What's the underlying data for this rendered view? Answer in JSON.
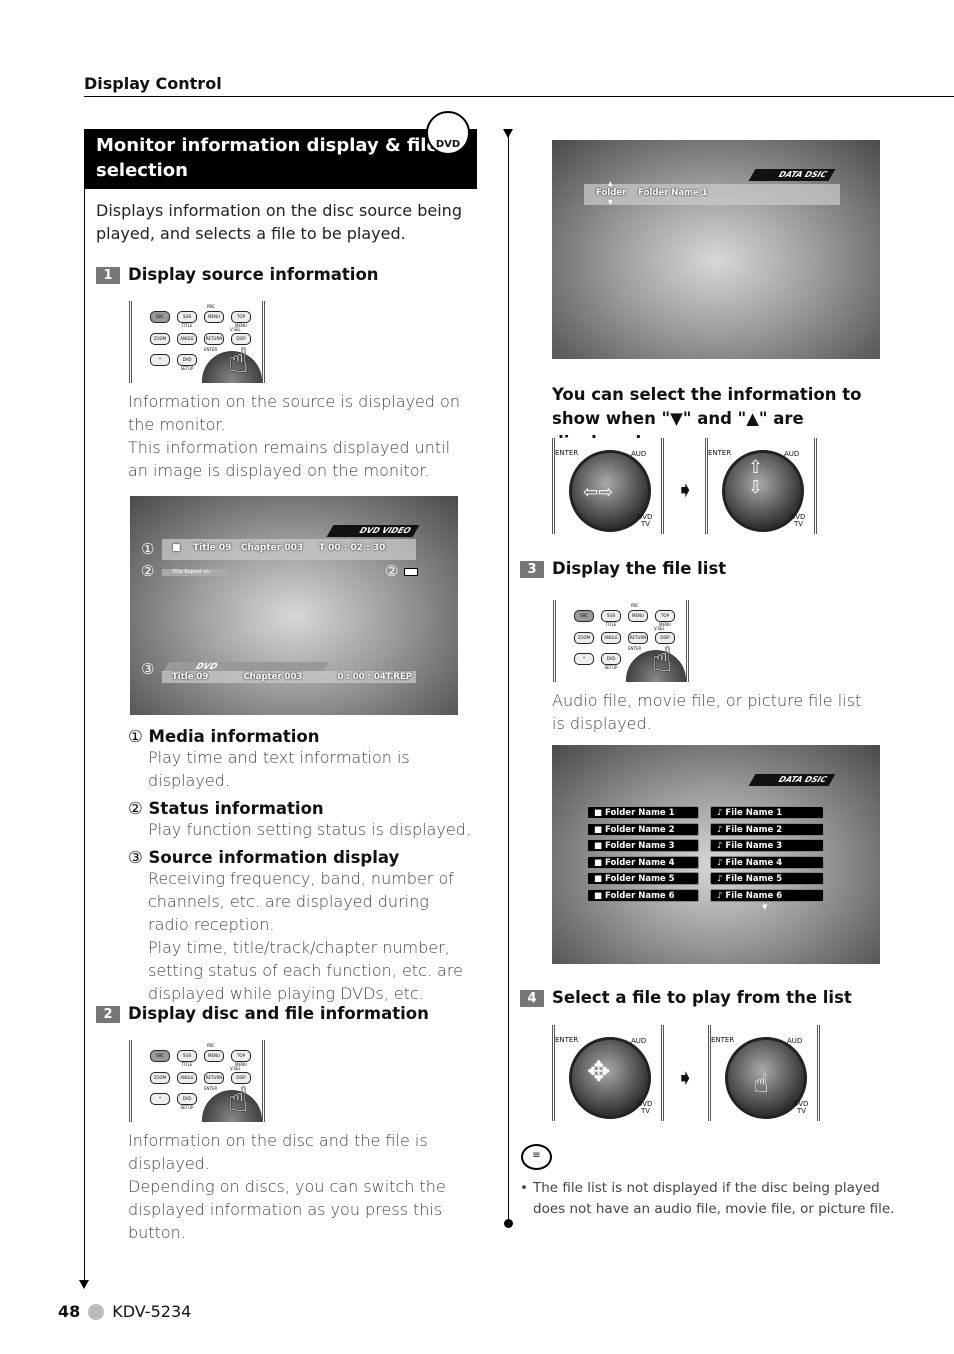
{
  "header": {
    "section": "Display Control"
  },
  "title": {
    "text": "Monitor information display & file selection",
    "badge": "DVD"
  },
  "intro": "Displays information on the disc source being played, and selects a file to be played.",
  "steps": [
    {
      "num": "1",
      "title": "Display source information",
      "text1": "Information on the source is displayed on the monitor.",
      "text2": "This information remains displayed until an image is displayed on the monitor."
    },
    {
      "num": "2",
      "title": "Display disc and file information",
      "text1": "Information on the disc and the file is displayed.",
      "text2": "Depending on discs, you can switch the displayed information as you press this button."
    },
    {
      "num": "3",
      "title": "Display the file list",
      "text1": "Audio file, movie file, or picture file list is displayed."
    },
    {
      "num": "4",
      "title": "Select a file to play from the list"
    }
  ],
  "remote": {
    "buttons": [
      "SRC",
      "SUB TITLE",
      "MENU",
      "TOP MENU",
      "ZOOM",
      "ANGLE",
      "RETURN",
      "DISP",
      "*",
      "DVD SETUP"
    ],
    "labels": [
      "PBC",
      "V.SEL",
      "ENTER"
    ]
  },
  "dvd_screen": {
    "header": "DVD VIDEO",
    "media": {
      "title_label": "Title",
      "title": "09",
      "chapter_label": "Chapter",
      "chapter": "003",
      "time": "T  00 : 02 : 30"
    },
    "status": "Title Repeat on",
    "source": {
      "name": "DVD",
      "title": "Title    09",
      "chapter": "Chapter 003",
      "time": "0 : 00 : 04T.REP"
    },
    "markers": [
      "①",
      "②",
      "②",
      "③"
    ]
  },
  "folder_screen": {
    "header": "DATA DSIC",
    "folder_label": "Folder",
    "folder_name": "Folder Name 1"
  },
  "select_info": "You can select the information to show when \"▼\" and \"▲\" are displayed.",
  "pad_labels": {
    "enter": "ENTER",
    "aud": "AUD",
    "dvd": "DVD",
    "tv": "TV"
  },
  "list_screen": {
    "header": "DATA DSIC",
    "folders": [
      "Folder Name 1",
      "Folder Name 2",
      "Folder Name 3",
      "Folder Name 4",
      "Folder Name 5",
      "Folder Name 6"
    ],
    "files": [
      "File Name 1",
      "File Name 2",
      "File Name 3",
      "File Name 4",
      "File Name 5",
      "File Name 6"
    ]
  },
  "legend": [
    {
      "mark": "①",
      "title": "Media information",
      "text": "Play time and text information is displayed."
    },
    {
      "mark": "②",
      "title": "Status information",
      "text": "Play function setting status is displayed."
    },
    {
      "mark": "③",
      "title": "Source information display",
      "text": "Receiving frequency, band, number of channels, etc. are displayed during radio reception.",
      "text2": "Play time, title/track/chapter number, setting status of  each function, etc. are displayed while playing DVDs, etc."
    }
  ],
  "note": "The file list is not displayed if the disc being played does not have an audio file, movie file, or picture file.",
  "footer": {
    "page": "48",
    "model": "KDV-5234"
  }
}
